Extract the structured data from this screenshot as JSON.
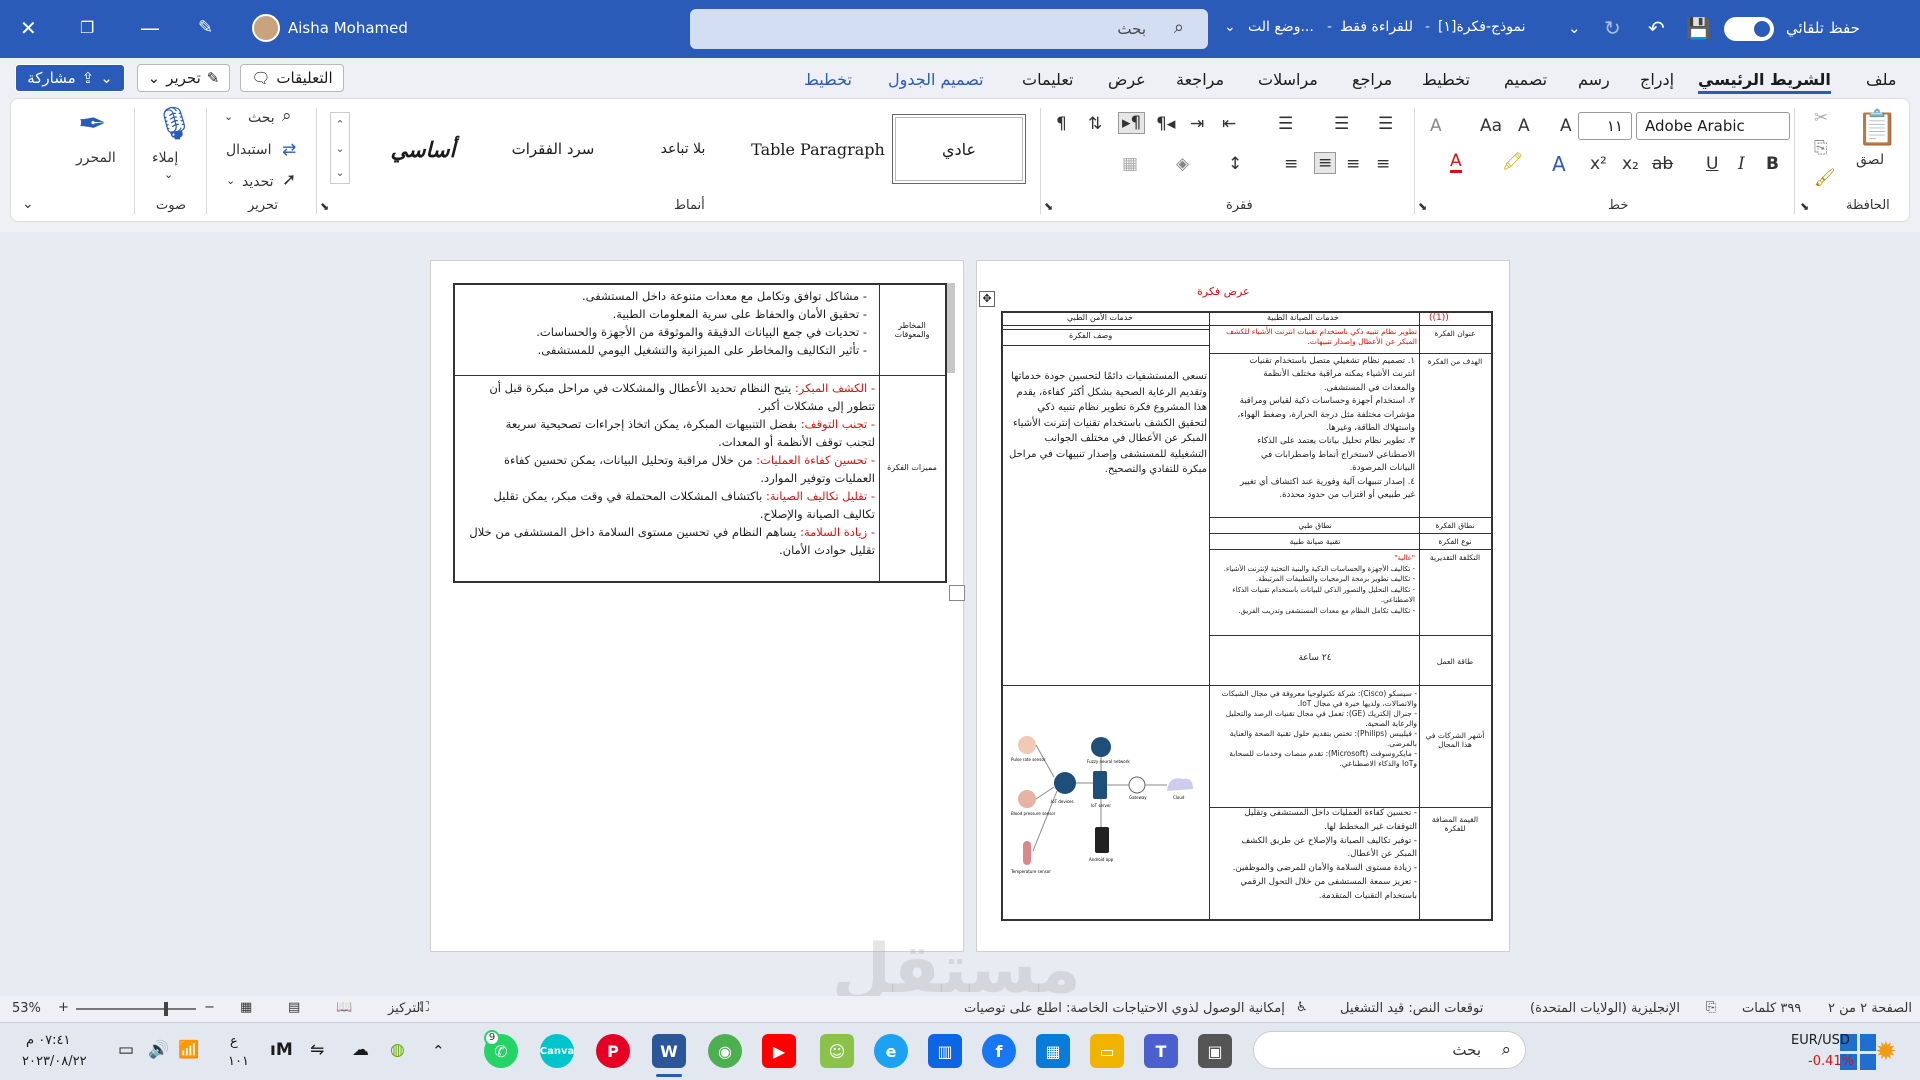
{
  "titlebar": {
    "doc_title": "نموذج-فكرة[١]",
    "mode": "للقراءة فقط",
    "mode_suffix": "وضع الت...",
    "autosave_label": "حفظ تلقائي",
    "search_placeholder": "بحث",
    "user_name": "Aisha Mohamed"
  },
  "menu": {
    "tabs": [
      "ملف",
      "الشريط الرئيسي",
      "إدراج",
      "رسم",
      "تصميم",
      "تخطيط",
      "مراجع",
      "مراسلات",
      "مراجعة",
      "عرض",
      "تعليمات",
      "تصميم الجدول",
      "تخطيط"
    ],
    "comments": "التعليقات",
    "edit": "تحرير",
    "share": "مشاركة"
  },
  "ribbon": {
    "clipboard": {
      "paste": "لصق",
      "label": "الحافظة"
    },
    "font": {
      "name": "Adobe Arabic",
      "size": "١١",
      "label": "خط"
    },
    "paragraph": {
      "label": "فقرة"
    },
    "styles": {
      "items": [
        "عادي",
        "Table Paragraph",
        "بلا تباعد",
        "سرد الفقرات",
        "أساسي"
      ],
      "label": "أنماط"
    },
    "editing": {
      "find": "بحث",
      "replace": "استبدال",
      "select": "تحديد",
      "label": "تحرير"
    },
    "voice": {
      "dictate": "إملاء",
      "label": "صوت"
    },
    "editor": {
      "label": "المحرر"
    }
  },
  "page1": {
    "heading": "عرض فكرة",
    "col_headers": [
      "((1))",
      "خدمات الصيانة الطبية",
      "خدمات الأمن الطبي"
    ],
    "rows": [
      {
        "label": "عنوان الفكرة",
        "content": "تطوير نظام تنبيه ذكي باستخدام تقنيات انترنت الأشياء للكشف المبكر عن الأعطال وإصدار تنبيهات.",
        "desc_label": "وصف الفكرة"
      },
      {
        "label": "الهدف من الفكرة",
        "lines": [
          "١. تصميم نظام تشغيلي متصل باستخدام تقنيات",
          "انترنت الأشياء يمكنه مراقبة مختلف الأنظمة",
          "والمعدات في المستشفى.",
          "٢. استخدام أجهزة وحساسات ذكية لقياس ومراقبة",
          "مؤشرات مختلفة مثل درجة الحرارة، وضغط الهواء،",
          "واستهلاك الطاقة، وغيرها.",
          "٣. تطوير نظام تحليل بيانات يعتمد على الذكاء",
          "الاصطناعي لاستخراج أنماط واضطرابات في",
          "البيانات المرصودة.",
          "٤. إصدار تنبيهات آلية وفورية عند اكتشاف أي تغيير",
          "غير طبيعي أو اقتراب من حدود محددة."
        ]
      },
      {
        "label": "نطاق الفكرة",
        "content": "نطاق طبي"
      },
      {
        "label": "نوع الفكرة",
        "content": "تقنية صيانة طبية"
      },
      {
        "label": "التكلفة التقديرية",
        "lines": [
          "\"عالية\"",
          "- تكاليف الأجهزة والحساسات الذكية والبنية التحتية لإنترنت الأشياء.",
          "- تكاليف تطوير برمجة البرمجيات والتطبيقات المرتبطة.",
          "- تكاليف التحليل والتصور الذكي للبيانات باستخدام تقنيات الذكاء",
          "الاصطناعي.",
          "- تكاليف تكامل النظام مع معدات المستشفى وتدريب الفريق."
        ]
      },
      {
        "label": "طاقة العمل",
        "content": "٢٤ ساعة"
      },
      {
        "label": "أشهر الشركات في هذا المجال",
        "lines": [
          "- سيسكو (Cisco): شركة تكنولوجيا معروفة في مجال الشبكات",
          "والاتصالات، ولديها خبرة في مجال IoT.",
          "- جنرال إلكتريك (GE): تعمل في مجال تقنيات الرصد والتحليل",
          "والرعاية الصحية.",
          "- فيليبس (Philips): تختص بتقديم حلول تقنية الصحة والعناية",
          "بالمرضى.",
          "- مايكروسوفت (Microsoft): تقدم منصات وخدمات للسحابة",
          "وIoT والذكاء الاصطناعي."
        ]
      },
      {
        "label": "القيمة المضافة للفكرة",
        "lines": [
          "- تحسين كفاءة العمليات داخل المستشفى وتقليل",
          "التوقفات غير المخطط لها.",
          "- توفير تكاليف الصيانة والإصلاح عن طريق الكشف",
          "المبكر عن الأعطال.",
          "- زيادة مستوى السلامة والأمان للمرضى والموظفين.",
          "- تعزيز سمعة المستشفى من خلال التحول الرقمي",
          "باستخدام التقنيات المتقدمة."
        ]
      }
    ],
    "desc_lines": [
      "تسعى المستشفيات دائمًا لتحسين جودة خدماتها",
      "وتقديم الرعاية الصحية بشكل أكثر كفاءة، يقدم",
      "هذا المشروع فكرة تطوير نظام تنبيه ذكي",
      "لتحقيق الكشف باستخدام تقنيات إنترنت الأشياء",
      "المبكر عن الأعطال في مختلف الجوانب",
      "التشغيلية للمستشفى وإصدار تنبيهات في مراحل",
      "مبكرة للتفادي والتصحيح."
    ],
    "diagram": {
      "sensors": [
        "Pulse rate sensor",
        "Blood pressure sensor",
        "Temperature sensor"
      ],
      "nodes": [
        "IoT devices",
        "Fuzzy neural network",
        "IoT server",
        "Gateway",
        "Cloud",
        "Android app"
      ]
    }
  },
  "page2": {
    "row1_label": "المخاطر والمعوقات",
    "row1_lines": [
      "- مشاكل توافق وتكامل مع معدات متنوعة داخل المستشفى.",
      "- تحقيق الأمان والحفاظ على سرية المعلومات الطبية.",
      "- تحديات في جمع البيانات الدقيقة والموثوقة من الأجهزة والحساسات.",
      "- تأثير التكاليف والمخاطر على الميزانية والتشغيل اليومي للمستشفى."
    ],
    "row2_label": "مميزات الفكرة",
    "row2_items": [
      {
        "title": "الكشف المبكر:",
        "lines": [
          "يتيح النظام تحديد الأعطال والمشكلات في مراحل مبكرة قبل أن",
          "تتطور إلى مشكلات أكبر."
        ]
      },
      {
        "title": "تجنب التوقف:",
        "lines": [
          "بفضل التنبيهات المبكرة، يمكن اتخاذ إجراءات تصحيحية سريعة",
          "لتجنب توقف الأنظمة أو المعدات."
        ]
      },
      {
        "title": "تحسين كفاءة العمليات:",
        "lines": [
          "من خلال مراقبة وتحليل البيانات، يمكن تحسين كفاءة",
          "العمليات وتوفير الموارد."
        ]
      },
      {
        "title": "تقليل تكاليف الصيانة:",
        "lines": [
          "باكتشاف المشكلات المحتملة في وقت مبكر، يمكن تقليل",
          "تكاليف الصيانة والإصلاح."
        ]
      },
      {
        "title": "زيادة السلامة:",
        "lines": [
          "يساهم النظام في تحسين مستوى السلامة داخل المستشفى من خلال",
          "تقليل حوادث الأمان."
        ]
      }
    ]
  },
  "statusbar": {
    "page": "الصفحة ٢ من ٢",
    "words": "٣٩٩ كلمات",
    "lang": "الإنجليزية (الولايات المتحدة)",
    "predict": "توقعات النص: قيد التشغيل",
    "access": "إمكانية الوصول لذوي الاحتياجات الخاصة: اطلع على توصيات",
    "focus": "التركيز",
    "zoom": "53%"
  },
  "taskbar": {
    "search": "بحث",
    "currency": "EUR/USD",
    "change": "-0.41%",
    "time": "٠٧:٤١ م",
    "date": "٢٠٢٣/٠٨/٢٢",
    "lang": "ع",
    "lang2": "١٠١",
    "wa_badge": "9"
  },
  "watermark": "مستقل"
}
